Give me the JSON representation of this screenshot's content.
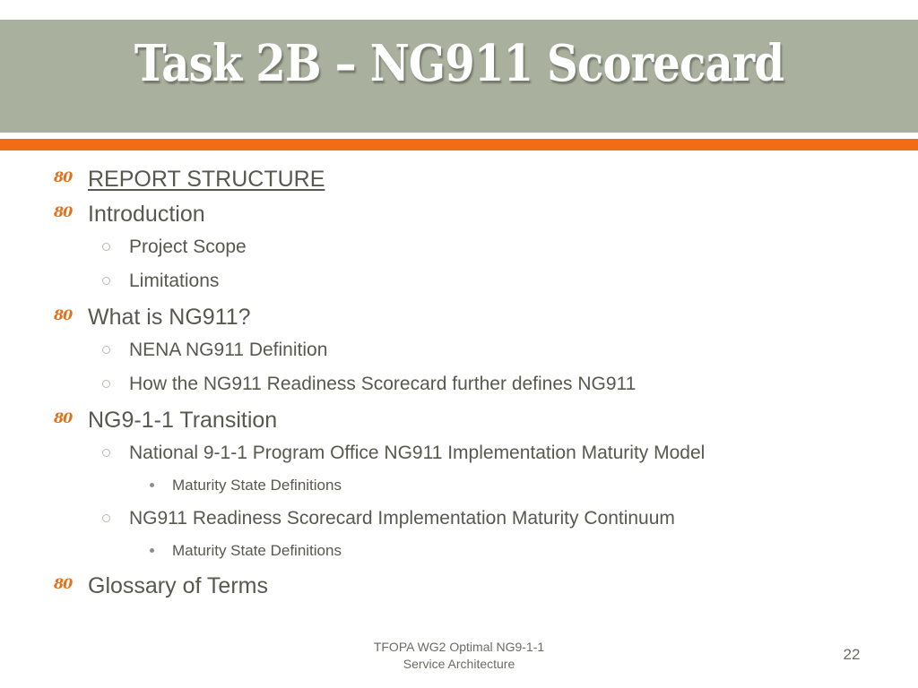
{
  "slide": {
    "title": "Task 2B – NG911 Scorecard",
    "colors": {
      "header_band": "#aab09e",
      "accent_rule": "#f06d15",
      "bullet_orange": "#e2711d",
      "body_text": "#58584f",
      "background": "#ffffff"
    }
  },
  "outline": [
    {
      "level": 1,
      "bullet": "80",
      "text": "REPORT STRUCTURE",
      "underline": true
    },
    {
      "level": 1,
      "bullet": "80",
      "text": "Introduction",
      "underline": false
    },
    {
      "level": 2,
      "bullet": "hollow-circle",
      "text": "Project Scope"
    },
    {
      "level": 2,
      "bullet": "hollow-circle",
      "text": "Limitations"
    },
    {
      "level": 1,
      "bullet": "80",
      "text": "What is NG911?",
      "underline": false
    },
    {
      "level": 2,
      "bullet": "hollow-circle",
      "text": "NENA NG911 Definition"
    },
    {
      "level": 2,
      "bullet": "hollow-circle",
      "text": "How the NG911 Readiness Scorecard further defines NG911"
    },
    {
      "level": 1,
      "bullet": "80",
      "text": "NG9-1-1 Transition",
      "underline": false
    },
    {
      "level": 2,
      "bullet": "hollow-circle",
      "text": "National 9-1-1 Program Office NG911 Implementation Maturity Model"
    },
    {
      "level": 3,
      "bullet": "filled-dot",
      "text": "Maturity State Definitions"
    },
    {
      "level": 2,
      "bullet": "hollow-circle",
      "text": "NG911 Readiness Scorecard Implementation Maturity Continuum"
    },
    {
      "level": 3,
      "bullet": "filled-dot",
      "text": "Maturity State Definitions"
    },
    {
      "level": 1,
      "bullet": "80",
      "text": "Glossary of Terms",
      "underline": false
    }
  ],
  "footer": {
    "line1": "TFOPA WG2 Optimal NG9-1-1",
    "line2": "Service Architecture",
    "page_number": "22"
  }
}
